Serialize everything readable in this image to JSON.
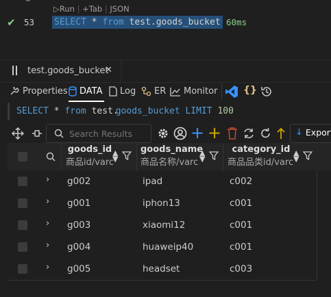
{
  "editor": {
    "line_number": "53",
    "codelens": {
      "run": "Run",
      "tab": "Tab",
      "json": "JSON"
    },
    "sql_tokens": {
      "kw1": "SELECT",
      "star": "*",
      "kw2": "from",
      "table": "test.goods_bucket"
    },
    "duration": "60ms"
  },
  "panel": {
    "tab_title": "test.goods_bucket",
    "close_glyph": "✕"
  },
  "toolbar": {
    "properties": "Properties",
    "data": "DATA",
    "log": "Log",
    "er": "ER",
    "monitor": "Monitor"
  },
  "query": {
    "kw1": "SELECT",
    "star": "*",
    "kw2": "from",
    "table_prefix": "test.",
    "table_name": "goods_bucket",
    "kw3": "LIMIT",
    "limit": "100"
  },
  "results_toolbar": {
    "search_placeholder": "Search Results",
    "export_label": "Export"
  },
  "table": {
    "columns": [
      {
        "name": "goods_id",
        "type": "商品id/varc"
      },
      {
        "name": "goods_name",
        "type": "商品名称/varc"
      },
      {
        "name": "category_id",
        "type": "商品品类id/varc"
      }
    ],
    "rows": [
      [
        "g002",
        "ipad",
        "c002"
      ],
      [
        "g001",
        "iphon13",
        "c001"
      ],
      [
        "g003",
        "xiaomi12",
        "c001"
      ],
      [
        "g004",
        "huaweip40",
        "c001"
      ],
      [
        "g005",
        "headset",
        "c003"
      ]
    ]
  },
  "colors": {
    "background": "#1f1f1f",
    "keyword": "#569cd6",
    "number": "#b5cea8",
    "selection": "#264f78",
    "success": "#89d185",
    "vscode_blue": "#3794ff",
    "plus_yellow": "#cca700",
    "trash_red": "#c74e39"
  }
}
